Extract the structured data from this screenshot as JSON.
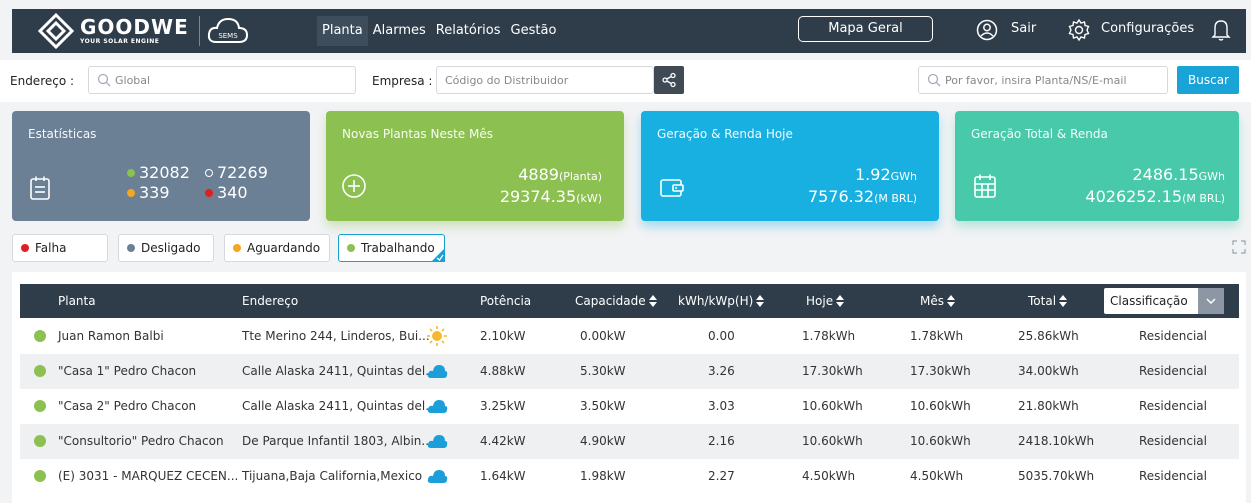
{
  "brand": {
    "name": "GOODWE",
    "tagline": "YOUR SOLAR ENGINE",
    "product": "SEMS"
  },
  "nav": {
    "items": [
      "Planta",
      "Alarmes",
      "Relatórios",
      "Gestão"
    ],
    "active": 0
  },
  "header": {
    "map_label": "Mapa Geral",
    "logout_label": "Sair",
    "settings_label": "Configurações"
  },
  "filters": {
    "address_label": "Endereço :",
    "address_placeholder": "Global",
    "company_label": "Empresa :",
    "company_placeholder": "Código do Distribuidor",
    "search_placeholder": "Por favor, insira Planta/NS/E-mail",
    "search_button": "Buscar"
  },
  "cards": {
    "stats": {
      "title": "Estatísticas",
      "green": "32082",
      "white": "72269",
      "orange": "339",
      "red": "340"
    },
    "new_plants": {
      "title": "Novas Plantas Neste Mês",
      "count": "4889",
      "count_unit": "(Planta)",
      "power": "29374.35",
      "power_unit": "(kW)"
    },
    "today": {
      "title": "Geração & Renda Hoje",
      "energy": "1.92",
      "energy_unit": "GWh",
      "income": "7576.32",
      "income_unit": "(M BRL)"
    },
    "total": {
      "title": "Geração Total & Renda",
      "energy": "2486.15",
      "energy_unit": "GWh",
      "income": "4026252.15",
      "income_unit": "(M BRL)"
    }
  },
  "legend": [
    "Falha",
    "Desligado",
    "Aguardando",
    "Trabalhando"
  ],
  "table": {
    "headers": [
      "Planta",
      "Endereço",
      "Potência",
      "Capacidade",
      "kWh/kWp(H)",
      "Hoje",
      "Mês",
      "Total"
    ],
    "classification_label": "Classificação",
    "rows": [
      {
        "plant": "Juan Ramon Balbi",
        "address": "Tte Merino 244, Linderos, Bui...",
        "weather": "sun",
        "power": "2.10kW",
        "capacity": "0.00kW",
        "ratio": "0.00",
        "today": "1.78kWh",
        "month": "1.78kWh",
        "total": "25.86kWh",
        "type": "Residencial"
      },
      {
        "plant": "\"Casa 1\" Pedro Chacon",
        "address": "Calle Alaska 2411, Quintas del...",
        "weather": "cloud",
        "power": "4.88kW",
        "capacity": "5.30kW",
        "ratio": "3.26",
        "today": "17.30kWh",
        "month": "17.30kWh",
        "total": "34.00kWh",
        "type": "Residencial"
      },
      {
        "plant": "\"Casa 2\" Pedro Chacon",
        "address": "Calle Alaska 2411, Quintas del...",
        "weather": "cloud",
        "power": "3.25kW",
        "capacity": "3.50kW",
        "ratio": "3.03",
        "today": "10.60kWh",
        "month": "10.60kWh",
        "total": "21.80kWh",
        "type": "Residencial"
      },
      {
        "plant": "\"Consultorio\" Pedro Chacon",
        "address": "De Parque Infantil 1803, Albin...",
        "weather": "cloud",
        "power": "4.42kW",
        "capacity": "4.90kW",
        "ratio": "2.16",
        "today": "10.60kWh",
        "month": "10.60kWh",
        "total": "2418.10kWh",
        "type": "Residencial"
      },
      {
        "plant": "(E) 3031 - MARQUEZ CECEN...",
        "address": "Tijuana,Baja California,Mexico",
        "weather": "cloud",
        "power": "1.64kW",
        "capacity": "1.98kW",
        "ratio": "2.27",
        "today": "4.50kWh",
        "month": "4.50kWh",
        "total": "5035.70kWh",
        "type": "Residencial"
      }
    ]
  },
  "colors": {
    "navbar": "#2f3d4a",
    "accent": "#1aa3d6",
    "green": "#8cc152",
    "blue": "#17b0e1",
    "teal": "#48c9a9",
    "slate": "#6b7f95",
    "red": "#e02020",
    "orange": "#f5a623"
  }
}
